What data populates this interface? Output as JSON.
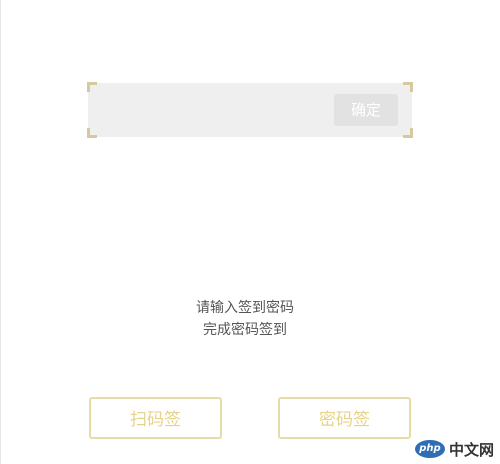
{
  "input_panel": {
    "placeholder": "",
    "confirm_label": "确定"
  },
  "instructions": {
    "line1": "请输入签到密码",
    "line2": "完成密码签到"
  },
  "mode_buttons": {
    "scan_label": "扫码签",
    "password_label": "密码签"
  },
  "watermark": {
    "logo_text": "php",
    "site_text": "中文网"
  },
  "colors": {
    "accent_border": "#e6dca8",
    "accent_text": "#e6d38a",
    "panel_bg": "#efefef",
    "confirm_bg": "#e2e2e2"
  }
}
